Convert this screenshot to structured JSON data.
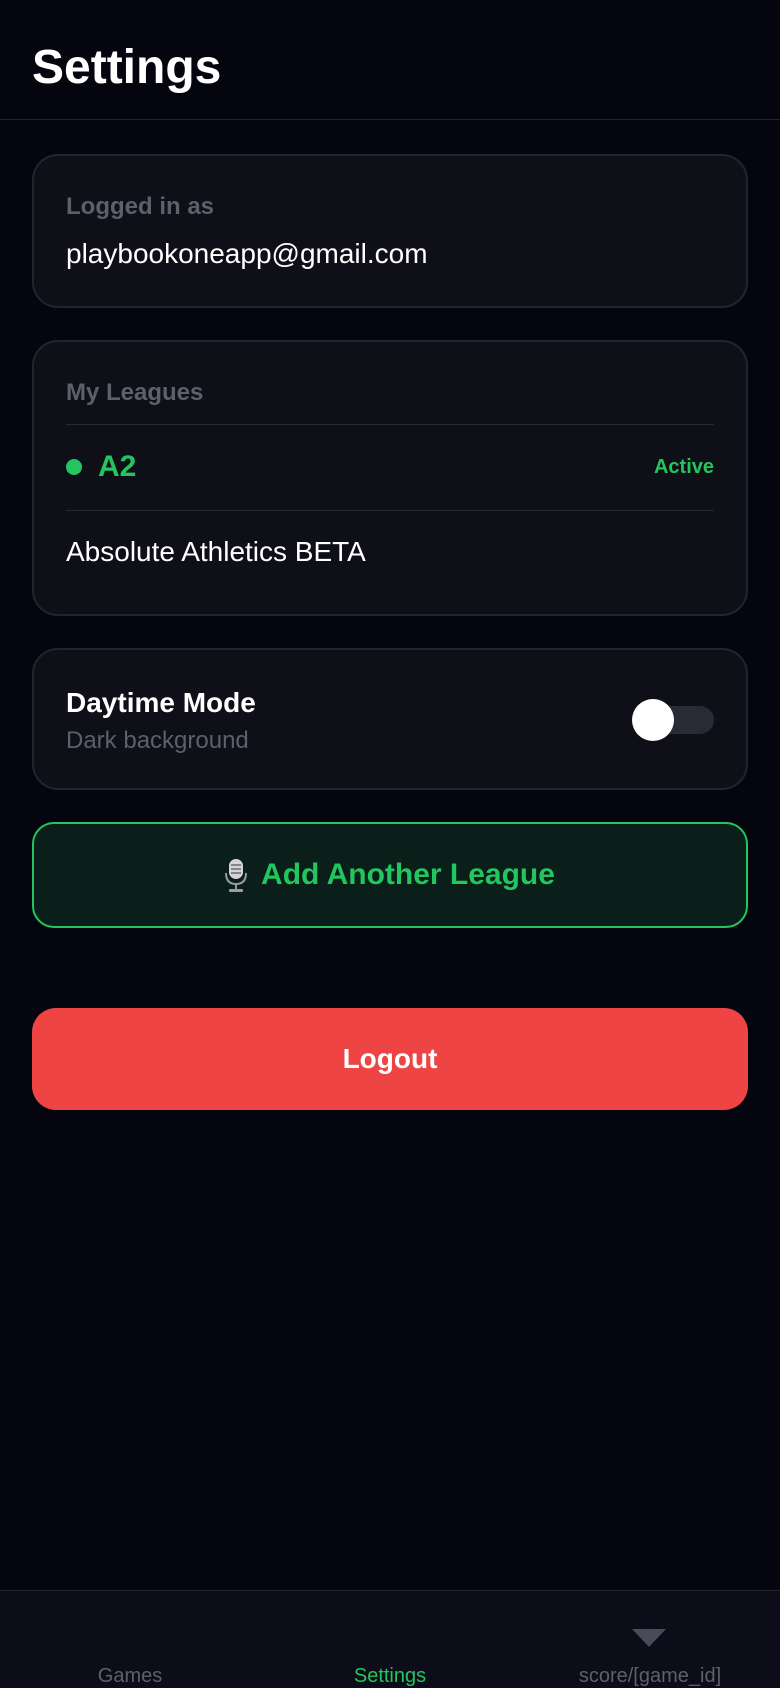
{
  "header": {
    "title": "Settings"
  },
  "account": {
    "label": "Logged in as",
    "email": "playbookoneapp@gmail.com"
  },
  "leagues": {
    "label": "My Leagues",
    "items": [
      {
        "name": "A2",
        "status": "Active"
      },
      {
        "name": "Absolute Athletics BETA"
      }
    ]
  },
  "daytime": {
    "title": "Daytime Mode",
    "subtitle": "Dark background",
    "enabled": false
  },
  "add_league": {
    "label": "Add Another League",
    "icon": "microphone-icon"
  },
  "logout": {
    "label": "Logout"
  },
  "tabbar": {
    "tabs": [
      {
        "label": "Games"
      },
      {
        "label": "Settings",
        "active": true
      },
      {
        "label": "score/[game_id]",
        "icon": "caret-down-icon"
      }
    ]
  },
  "colors": {
    "background": "#05050f",
    "card": "#0f0f18",
    "accent": "#22c55e",
    "danger": "#ef4444",
    "muted": "#5f5f6c"
  }
}
